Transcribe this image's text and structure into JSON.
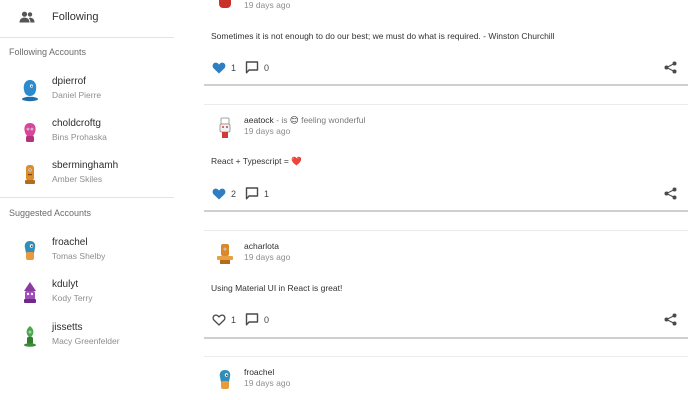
{
  "sidebar": {
    "following_label": "Following",
    "following_header": "Following Accounts",
    "suggested_header": "Suggested Accounts",
    "following_accounts": [
      {
        "username": "dpierrof",
        "fullname": "Daniel Pierre",
        "avatar_color": "#2a8ccf"
      },
      {
        "username": "choldcroftg",
        "fullname": "Bins Prohaska",
        "avatar_color": "#d8459a"
      },
      {
        "username": "sberminghamh",
        "fullname": "Amber Skiles",
        "avatar_color": "#d98d2c"
      }
    ],
    "suggested_accounts": [
      {
        "username": "froachel",
        "fullname": "Tomas Shelby",
        "avatar_color": "#2f8fb8"
      },
      {
        "username": "kdulyt",
        "fullname": "Kody Terry",
        "avatar_color": "#8a3aa0"
      },
      {
        "username": "jissetts",
        "fullname": "Macy Greenfelder",
        "avatar_color": "#4aa84a"
      }
    ]
  },
  "feed": {
    "posts": [
      {
        "time": "19 days ago",
        "avatar_color": "#c8322b",
        "body": "Sometimes it is not enough to do our best; we must do what is required. - Winston Churchill",
        "likes": "1",
        "comments": "0",
        "liked": true
      },
      {
        "username": "aeatock",
        "status_prefix": " - is ",
        "status_emoji": "😊",
        "status_text": " feeling wonderful",
        "time": "19 days ago",
        "avatar_color": "#d23a3a",
        "body_text": "React + Typescript = ",
        "body_emoji": "❤️",
        "likes": "2",
        "comments": "1",
        "liked": true
      },
      {
        "username": "acharlota",
        "time": "19 days ago",
        "avatar_color": "#d9892a",
        "body": "Using Material UI in React is great!",
        "likes": "1",
        "comments": "0",
        "liked": false
      },
      {
        "username": "froachel",
        "time": "19 days ago",
        "avatar_color": "#2f8fb8"
      }
    ]
  },
  "colors": {
    "like_active": "#2f7ec2",
    "icon": "#4a4a4a",
    "divider": "#cfcfcf"
  }
}
